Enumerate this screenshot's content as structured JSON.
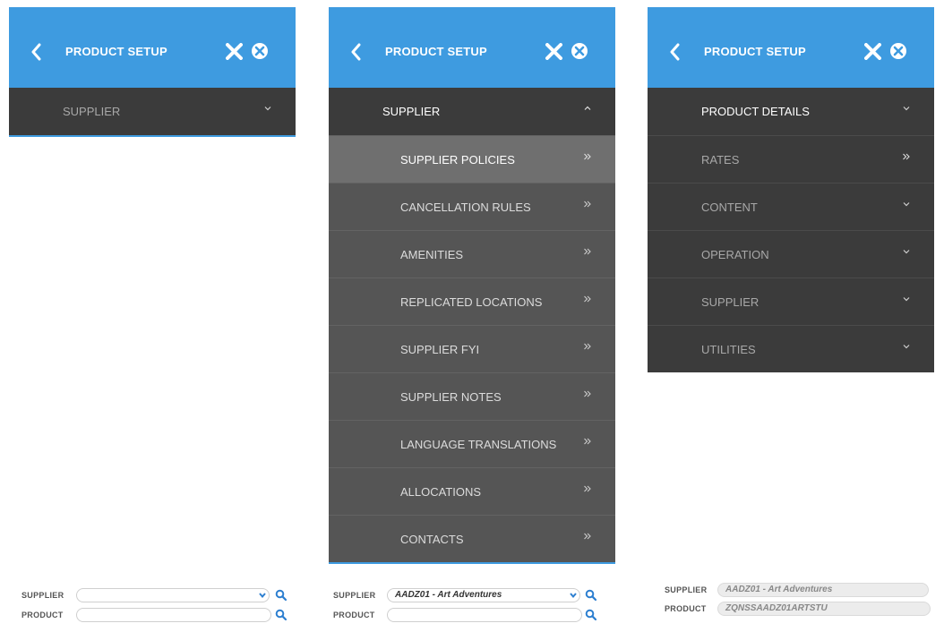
{
  "colors": {
    "header": "#3e9be0",
    "menu": "#3b3b3b",
    "submenu": "#555555",
    "highlight": "#6f6f6f"
  },
  "panels": [
    {
      "title": "PRODUCT SETUP",
      "menu": [
        {
          "label": "SUPPLIER",
          "chevron": "chevron-down",
          "active": false
        }
      ],
      "submenu": [],
      "form": {
        "supplier_label": "SUPPLIER",
        "supplier_value": "",
        "product_label": "PRODUCT",
        "product_value": ""
      }
    },
    {
      "title": "PRODUCT SETUP",
      "menu": [
        {
          "label": "SUPPLIER",
          "chevron": "chevron-up",
          "active": true
        }
      ],
      "submenu": [
        {
          "label": "SUPPLIER POLICIES"
        },
        {
          "label": "CANCELLATION RULES"
        },
        {
          "label": "AMENITIES"
        },
        {
          "label": "REPLICATED LOCATIONS"
        },
        {
          "label": "SUPPLIER FYI"
        },
        {
          "label": "SUPPLIER NOTES"
        },
        {
          "label": "LANGUAGE TRANSLATIONS"
        },
        {
          "label": "ALLOCATIONS"
        },
        {
          "label": "CONTACTS"
        }
      ],
      "form": {
        "supplier_label": "SUPPLIER",
        "supplier_value": "AADZ01 - Art Adventures",
        "product_label": "PRODUCT",
        "product_value": ""
      }
    },
    {
      "title": "PRODUCT SETUP",
      "menu": [
        {
          "label": "PRODUCT DETAILS",
          "chevron": "chevron-down",
          "active": true
        },
        {
          "label": "RATES",
          "chevron": "double-chevron-right",
          "active": false
        },
        {
          "label": "CONTENT",
          "chevron": "chevron-down",
          "active": false
        },
        {
          "label": "OPERATION",
          "chevron": "chevron-down",
          "active": false
        },
        {
          "label": "SUPPLIER",
          "chevron": "chevron-down",
          "active": false
        },
        {
          "label": "UTILITIES",
          "chevron": "chevron-down",
          "active": false
        }
      ],
      "submenu": [],
      "form": {
        "supplier_label": "SUPPLIER",
        "supplier_value": "AADZ01 - Art Adventures",
        "product_label": "PRODUCT",
        "product_value": "ZQNSSAADZ01ARTSTU"
      }
    }
  ]
}
